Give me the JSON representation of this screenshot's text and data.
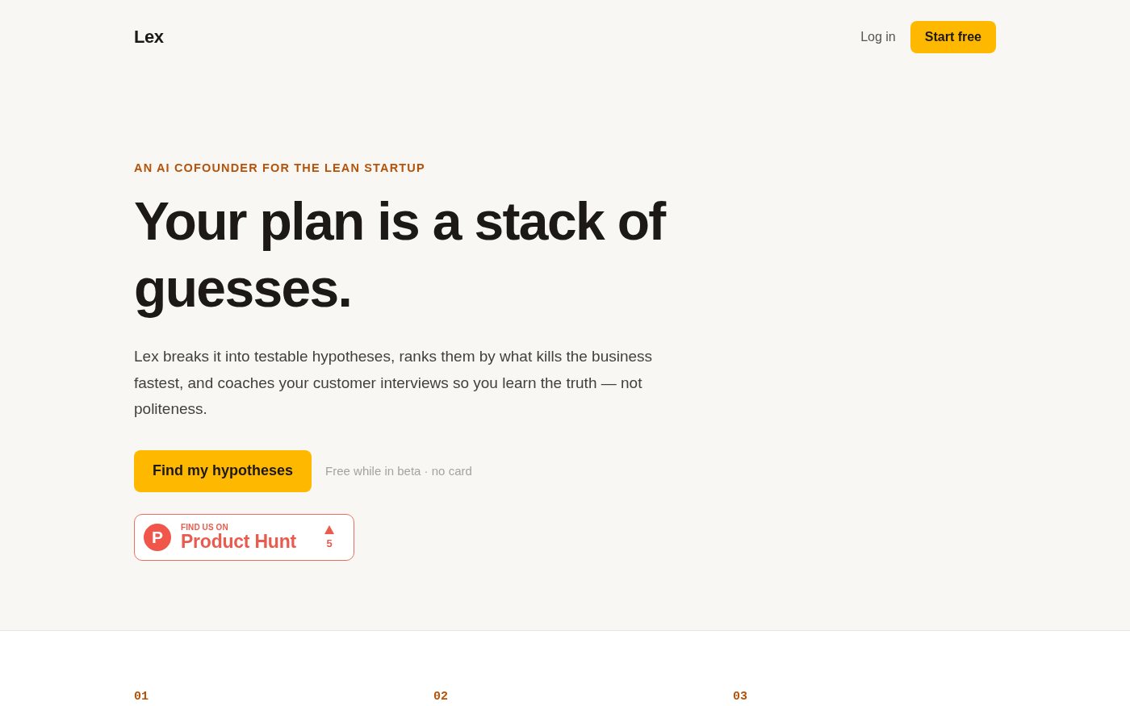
{
  "nav": {
    "logo": "Lex",
    "links": [
      {
        "label": "Log in",
        "kind": "link"
      },
      {
        "label": "Start free",
        "kind": "button"
      }
    ]
  },
  "hero": {
    "eyebrow": "AN AI COFOUNDER FOR THE LEAN STARTUP",
    "headline": "Your plan is a stack of guesses.",
    "description": "Lex breaks it into testable hypotheses, ranks them by what kills the business fastest, and coaches your customer interviews so you learn the truth — not politeness.",
    "cta": {
      "label": "Find my hypotheses"
    },
    "cta_note": "Free while in beta · no card",
    "badge": {
      "logo_letter": "P",
      "kicker": "FIND US ON",
      "name": "Product Hunt",
      "upvotes": "5"
    }
  },
  "steps": [
    {
      "number": "01"
    },
    {
      "number": "02"
    },
    {
      "number": "03"
    }
  ]
}
